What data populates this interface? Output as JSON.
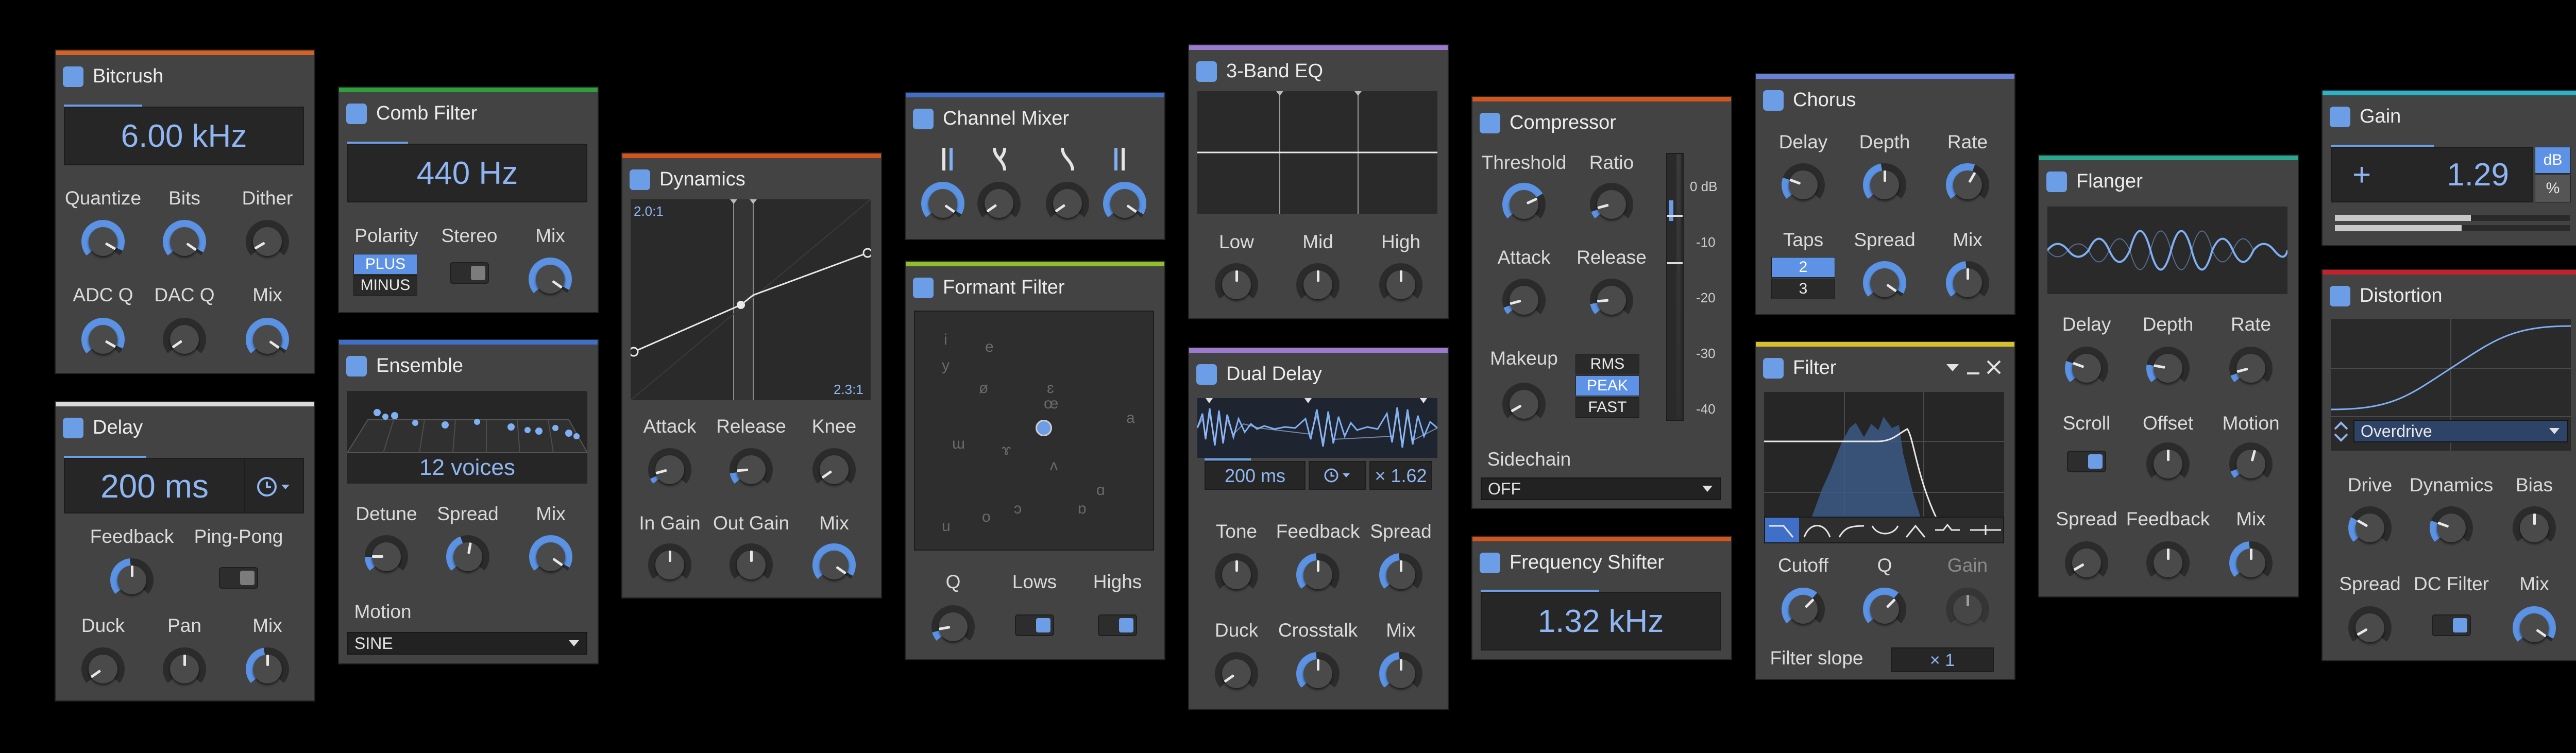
{
  "colors": {
    "accent": "#6c9ee8",
    "panel": "#434343",
    "bg": "#000000"
  },
  "bitcrush": {
    "title": "Bitcrush",
    "freq": "6.00 kHz",
    "knobs": [
      "Quantize",
      "Bits",
      "Dither",
      "ADC Q",
      "DAC Q",
      "Mix"
    ]
  },
  "delay": {
    "title": "Delay",
    "time": "200 ms",
    "feedback": "Feedback",
    "pingpong": "Ping-Pong",
    "duck": "Duck",
    "pan": "Pan",
    "mix": "Mix"
  },
  "comb": {
    "title": "Comb Filter",
    "freq": "440 Hz",
    "polarity": "Polarity",
    "stereo": "Stereo",
    "mix": "Mix",
    "plus": "PLUS",
    "minus": "MINUS"
  },
  "ensemble": {
    "title": "Ensemble",
    "voices": "12 voices",
    "detune": "Detune",
    "spread": "Spread",
    "mix": "Mix",
    "motion": "Motion",
    "motion_value": "SINE"
  },
  "dynamics": {
    "title": "Dynamics",
    "ratio_low": "2.0:1",
    "ratio_high": "2.3:1",
    "labels": [
      "Attack",
      "Release",
      "Knee",
      "In Gain",
      "Out Gain",
      "Mix"
    ]
  },
  "chmix": {
    "title": "Channel Mixer"
  },
  "formant": {
    "title": "Formant Filter",
    "vowels": [
      "i",
      "e",
      "y",
      "ø",
      "ɛ",
      "œ",
      "a",
      "ɯ",
      "ɤ",
      "ʌ",
      "ɑ",
      "ɒ",
      "u",
      "o",
      "ɔ"
    ],
    "q": "Q",
    "lows": "Lows",
    "highs": "Highs"
  },
  "eq": {
    "title": "3-Band EQ",
    "low": "Low",
    "mid": "Mid",
    "high": "High"
  },
  "dualdelay": {
    "title": "Dual Delay",
    "time": "200 ms",
    "mult": "× 1.62",
    "labels": [
      "Tone",
      "Feedback",
      "Spread",
      "Duck",
      "Crosstalk",
      "Mix"
    ]
  },
  "comp": {
    "title": "Compressor",
    "threshold": "Threshold",
    "ratio": "Ratio",
    "attack": "Attack",
    "release": "Release",
    "makeup": "Makeup",
    "modes": [
      "RMS",
      "PEAK",
      "FAST"
    ],
    "sidechain": "Sidechain",
    "sidechain_value": "OFF",
    "db": [
      "0 dB",
      "-10",
      "-20",
      "-30",
      "-40"
    ]
  },
  "freqshift": {
    "title": "Frequency Shifter",
    "value": "1.32 kHz"
  },
  "chorus": {
    "title": "Chorus",
    "delay": "Delay",
    "depth": "Depth",
    "rate": "Rate",
    "taps": "Taps",
    "spread": "Spread",
    "mix": "Mix",
    "tap_opts": [
      "2",
      "3"
    ]
  },
  "filter": {
    "title": "Filter",
    "cutoff": "Cutoff",
    "q": "Q",
    "gain": "Gain",
    "slope_label": "Filter slope",
    "slope_value": "× 1"
  },
  "flanger": {
    "title": "Flanger",
    "labels": [
      "Delay",
      "Depth",
      "Rate",
      "Scroll",
      "Offset",
      "Motion",
      "Spread",
      "Feedback",
      "Mix"
    ]
  },
  "gain": {
    "title": "Gain",
    "sign": "+",
    "value": "1.29",
    "unit_db": "dB",
    "unit_pct": "%"
  },
  "distortion": {
    "title": "Distortion",
    "type": "Overdrive",
    "labels": [
      "Drive",
      "Dynamics",
      "Bias",
      "Spread",
      "DC Filter",
      "Mix"
    ]
  }
}
